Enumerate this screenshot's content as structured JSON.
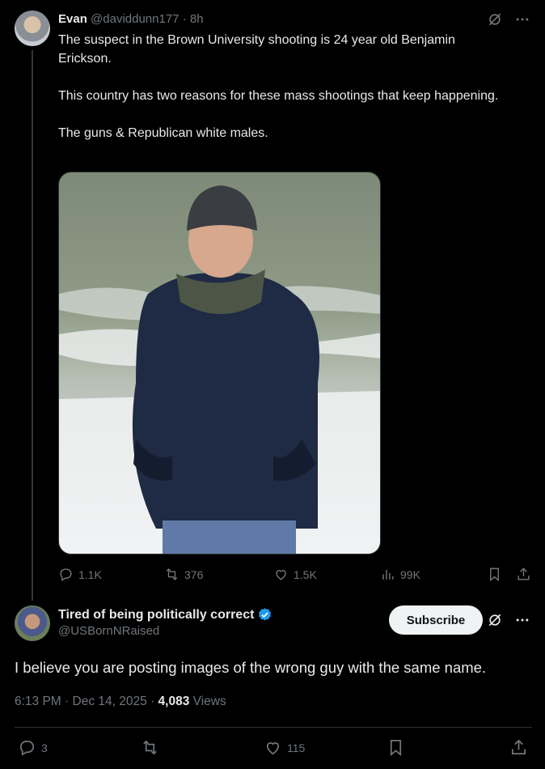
{
  "tweet": {
    "author_name": "Evan",
    "author_handle": "@daviddunn177",
    "separator": "·",
    "time_ago": "8h",
    "paragraphs": [
      "The suspect in the Brown University shooting is 24 year old Benjamin Erickson.",
      "This country has two reasons for these mass shootings that keep happening.",
      "The guns & Republican white males."
    ],
    "actions": {
      "replies": "1.1K",
      "reposts": "376",
      "likes": "1.5K",
      "views": "99K"
    }
  },
  "reply": {
    "author_name": "Tired of being politically correct",
    "author_handle": "@USBornNRaised",
    "subscribe_label": "Subscribe",
    "text": "I believe you are posting images of the wrong guy with the same name.",
    "time": "6:13 PM",
    "date": "Dec 14, 2025",
    "views_count": "4,083",
    "views_label": "Views",
    "actions": {
      "replies": "3",
      "likes": "115"
    }
  },
  "icons": {
    "reply": "reply-icon",
    "repost": "repost-icon",
    "like": "heart-icon",
    "views": "views-icon",
    "bookmark": "bookmark-icon",
    "share": "share-icon",
    "grok": "grok-icon",
    "more": "more-icon",
    "verified": "verified-badge-icon"
  },
  "colors": {
    "background": "#000000",
    "text": "#e7e9ea",
    "muted": "#71767b",
    "verified": "#1d9bf0",
    "button_bg": "#eff3f4"
  }
}
